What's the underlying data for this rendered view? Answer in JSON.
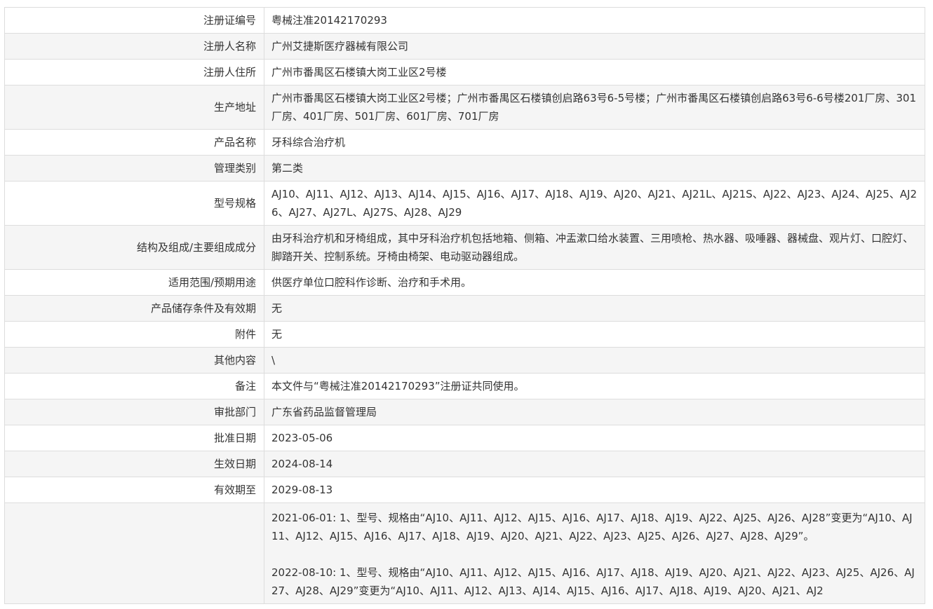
{
  "rows": [
    {
      "label": "注册证编号",
      "value": "粤械注准20142170293"
    },
    {
      "label": "注册人名称",
      "value": "广州艾捷斯医疗器械有限公司"
    },
    {
      "label": "注册人住所",
      "value": "广州市番禺区石楼镇大岗工业区2号楼"
    },
    {
      "label": "生产地址",
      "value": "广州市番禺区石楼镇大岗工业区2号楼；广州市番禺区石楼镇创启路63号6-5号楼；广州市番禺区石楼镇创启路63号6-6号楼201厂房、301厂房、401厂房、501厂房、601厂房、701厂房"
    },
    {
      "label": "产品名称",
      "value": "牙科综合治疗机"
    },
    {
      "label": "管理类别",
      "value": "第二类"
    },
    {
      "label": "型号规格",
      "value": "AJ10、AJ11、AJ12、AJ13、AJ14、AJ15、AJ16、AJ17、AJ18、AJ19、AJ20、AJ21、AJ21L、AJ21S、AJ22、AJ23、AJ24、AJ25、AJ26、AJ27、AJ27L、AJ27S、AJ28、AJ29"
    },
    {
      "label": "结构及组成/主要组成成分",
      "value": "由牙科治疗机和牙椅组成，其中牙科治疗机包括地箱、侧箱、冲盂漱口给水装置、三用喷枪、热水器、吸唾器、器械盘、观片灯、口腔灯、脚踏开关、控制系统。牙椅由椅架、电动驱动器组成。"
    },
    {
      "label": "适用范围/预期用途",
      "value": "供医疗单位口腔科作诊断、治疗和手术用。"
    },
    {
      "label": "产品储存条件及有效期",
      "value": "无"
    },
    {
      "label": "附件",
      "value": "无"
    },
    {
      "label": "其他内容",
      "value": "\\"
    },
    {
      "label": "备注",
      "value": "本文件与“粤械注准20142170293”注册证共同使用。"
    },
    {
      "label": "审批部门",
      "value": "广东省药品监督管理局"
    },
    {
      "label": "批准日期",
      "value": "2023-05-06"
    },
    {
      "label": "生效日期",
      "value": "2024-08-14"
    },
    {
      "label": "有效期至",
      "value": "2029-08-13"
    }
  ],
  "history": {
    "label": "",
    "entries": [
      "2021-06-01: 1、型号、规格由“AJ10、AJ11、AJ12、AJ15、AJ16、AJ17、AJ18、AJ19、AJ22、AJ25、AJ26、AJ28”变更为“AJ10、AJ11、AJ12、AJ15、AJ16、AJ17、AJ18、AJ19、AJ20、AJ21、AJ22、AJ23、AJ25、AJ26、AJ27、AJ28、AJ29”。",
      "2022-08-10: 1、型号、规格由“AJ10、AJ11、AJ12、AJ15、AJ16、AJ17、AJ18、AJ19、AJ20、AJ21、AJ22、AJ23、AJ25、AJ26、AJ27、AJ28、AJ29”变更为“AJ10、AJ11、AJ12、AJ13、AJ14、AJ15、AJ16、AJ17、AJ18、AJ19、AJ20、AJ21、AJ2"
    ]
  }
}
